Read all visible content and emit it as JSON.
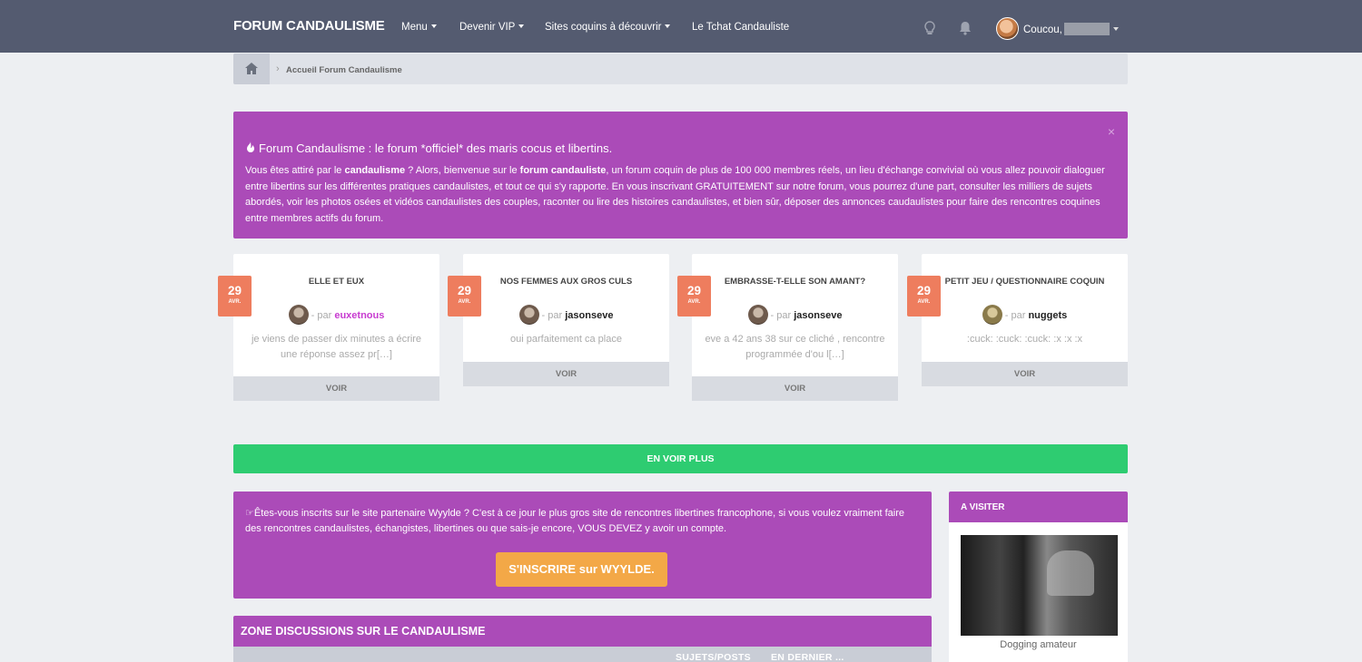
{
  "topbar": {
    "brand": "FORUM CANDAULISME",
    "nav": [
      {
        "label": "Menu",
        "dropdown": true
      },
      {
        "label": "Devenir VIP",
        "dropdown": true
      },
      {
        "label": "Sites coquins à découvrir",
        "dropdown": true
      },
      {
        "label": "Le Tchat Candauliste",
        "dropdown": false
      }
    ],
    "greeting": "Coucou,"
  },
  "breadcrumb": {
    "current": "Accueil Forum Candaulisme"
  },
  "alert": {
    "title": "Forum Candaulisme : le forum *officiel* des maris cocus et libertins.",
    "body_1": "Vous êtes attiré par le ",
    "body_bold_1": "candaulisme",
    "body_2": " ? Alors, bienvenue sur le ",
    "body_bold_2": "forum candauliste",
    "body_3": ", un forum coquin de plus de 100 000 membres réels, un lieu d'échange convivial où vous allez pouvoir dialoguer entre libertins sur les différentes pratiques candaulistes, et tout ce qui s'y rapporte. En vous inscrivant GRATUITEMENT sur notre forum, vous pourrez d'une part, consulter les milliers de sujets abordés, voir les photos osées et vidéos candaulistes des couples, raconter ou lire des histoires candaulistes, et bien sûr, déposer des annonces caudaulistes pour faire des rencontres coquines entre membres actifs du forum.",
    "close": "×"
  },
  "cards": [
    {
      "day": "29",
      "month": "AVR.",
      "title": "ELLE ET EUX",
      "by": "- par",
      "author": "euxetnous",
      "excerpt": "je viens de passer dix minutes a écrire une réponse assez pr[…]",
      "button": "VOIR"
    },
    {
      "day": "29",
      "month": "AVR.",
      "title": "NOS FEMMES AUX GROS CULS",
      "by": "- par",
      "author": "jasonseve",
      "excerpt": "oui parfaitement ca place",
      "button": "VOIR"
    },
    {
      "day": "29",
      "month": "AVR.",
      "title": "EMBRASSE-T-ELLE SON AMANT?",
      "by": "- par",
      "author": "jasonseve",
      "excerpt": "eve a 42 ans 38 sur ce cliché , rencontre programmée d'ou l[…]",
      "button": "VOIR"
    },
    {
      "day": "29",
      "month": "AVR.",
      "title": "PETIT JEU / QUESTIONNAIRE COQUIN",
      "by": "- par",
      "author": "nuggets",
      "excerpt": ":cuck: :cuck: :cuck: :x :x :x",
      "button": "VOIR"
    }
  ],
  "see_more": "EN VOIR PLUS",
  "partner": {
    "text": "Êtes-vous inscrits sur le site partenaire Wyylde ? C'est à ce jour le plus gros site de rencontres libertines francophone, si vous voulez vraiment faire des rencontres candaulistes, échangistes, libertines ou que sais-je encore, VOUS DEVEZ y avoir un compte.",
    "button": "S'INSCRIRE sur WYYLDE."
  },
  "zone": {
    "title": "ZONE DISCUSSIONS SUR LE CANDAULISME",
    "col_topics": "SUJETS/POSTS",
    "col_last": "EN DERNIER ..."
  },
  "side": {
    "title": "A VISITER",
    "caption": "Dogging amateur"
  },
  "colors": {
    "topbar": "#545b70",
    "purple": "#ab4bb8",
    "green": "#2ecc71",
    "date": "#ee7d5e",
    "orange": "#f3a847"
  }
}
